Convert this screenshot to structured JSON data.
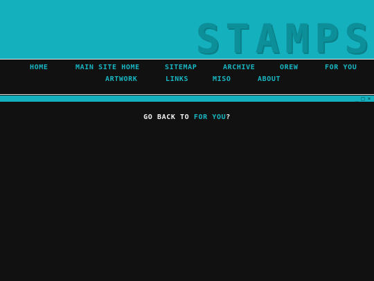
{
  "header": {
    "title": "STAMPS"
  },
  "nav": {
    "row1": [
      "HOME",
      "MAIN SITE HOME",
      "SITEMAP",
      "ARCHIVE",
      "OREW",
      "FOR YOU"
    ],
    "row2": [
      "ARTWORK",
      "LINKS",
      "MISO",
      "ABOUT"
    ]
  },
  "window": {
    "controls": {
      "minimize": "_",
      "maximize": "□",
      "close": "×"
    },
    "message": {
      "prefix": "GO BACK TO ",
      "link": "FOR YOU",
      "suffix": "?"
    }
  },
  "colors": {
    "accent": "#15b0bd",
    "background": "#111111",
    "text": "#f2f2f2"
  }
}
